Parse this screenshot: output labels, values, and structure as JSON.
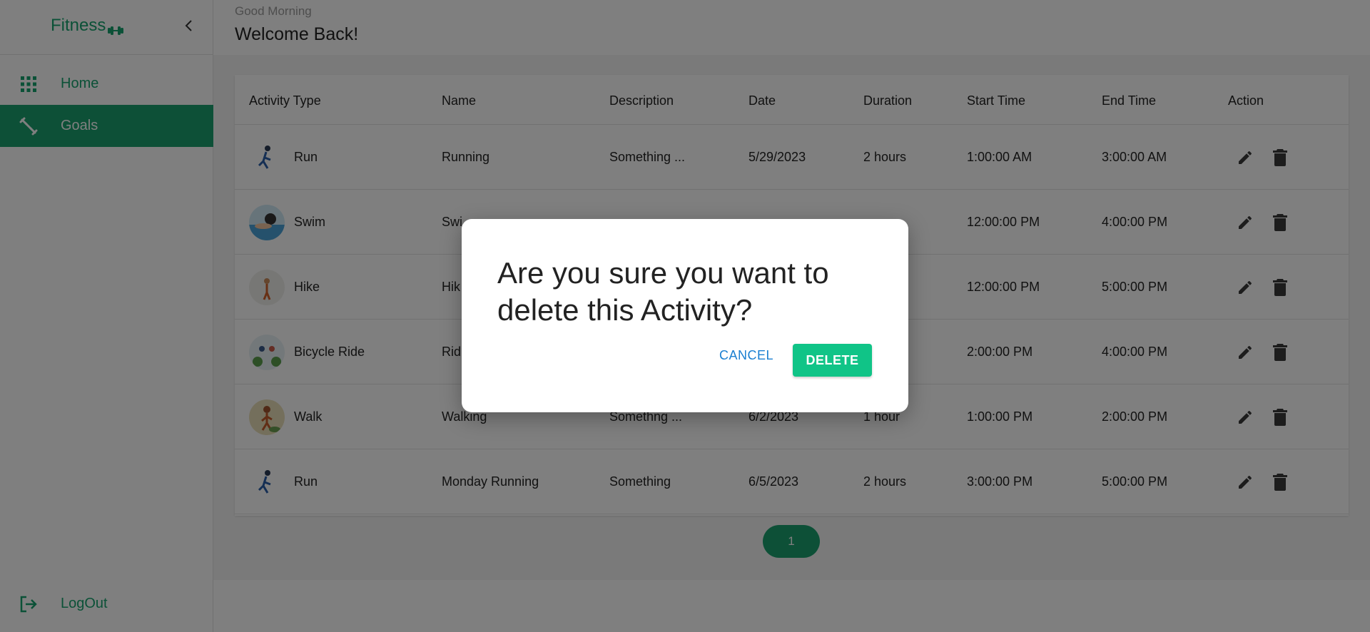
{
  "sidebar": {
    "brand": "Fitness",
    "brand_icon": "dumbbell-icon",
    "items": [
      {
        "label": "Home",
        "icon": "grid-icon"
      },
      {
        "label": "Goals",
        "icon": "fitness-icon"
      }
    ],
    "logout_label": "LogOut",
    "logout_icon": "logout-icon"
  },
  "header": {
    "greeting": "Good Morning",
    "welcome": "Welcome Back!"
  },
  "table": {
    "columns": [
      "Activity Type",
      "Name",
      "Description",
      "Date",
      "Duration",
      "Start Time",
      "End Time",
      "Action"
    ],
    "rows": [
      {
        "type": "Run",
        "name": "Running",
        "description": "Something ...",
        "date": "5/29/2023",
        "duration": "2 hours",
        "start": "1:00:00 AM",
        "end": "3:00:00 AM"
      },
      {
        "type": "Swim",
        "name": "Swi",
        "description": "",
        "date": "",
        "duration": "",
        "start": "12:00:00 PM",
        "end": "4:00:00 PM"
      },
      {
        "type": "Hike",
        "name": "Hik",
        "description": "",
        "date": "",
        "duration": "",
        "start": "12:00:00 PM",
        "end": "5:00:00 PM"
      },
      {
        "type": "Bicycle Ride",
        "name": "Rid",
        "description": "",
        "date": "",
        "duration": "",
        "start": "2:00:00 PM",
        "end": "4:00:00 PM"
      },
      {
        "type": "Walk",
        "name": "Walking",
        "description": "Somethng ...",
        "date": "6/2/2023",
        "duration": "1 hour",
        "start": "1:00:00 PM",
        "end": "2:00:00 PM"
      },
      {
        "type": "Run",
        "name": "Monday Running",
        "description": "Something",
        "date": "6/5/2023",
        "duration": "2 hours",
        "start": "3:00:00 PM",
        "end": "5:00:00 PM"
      }
    ]
  },
  "pagination": {
    "current": "1"
  },
  "dialog": {
    "title": "Are you sure you want to delete this Activity?",
    "cancel_label": "CANCEL",
    "delete_label": "DELETE"
  },
  "colors": {
    "brand": "#1aa06f",
    "delete_button": "#10c487",
    "cancel_link": "#1a7fd1"
  }
}
